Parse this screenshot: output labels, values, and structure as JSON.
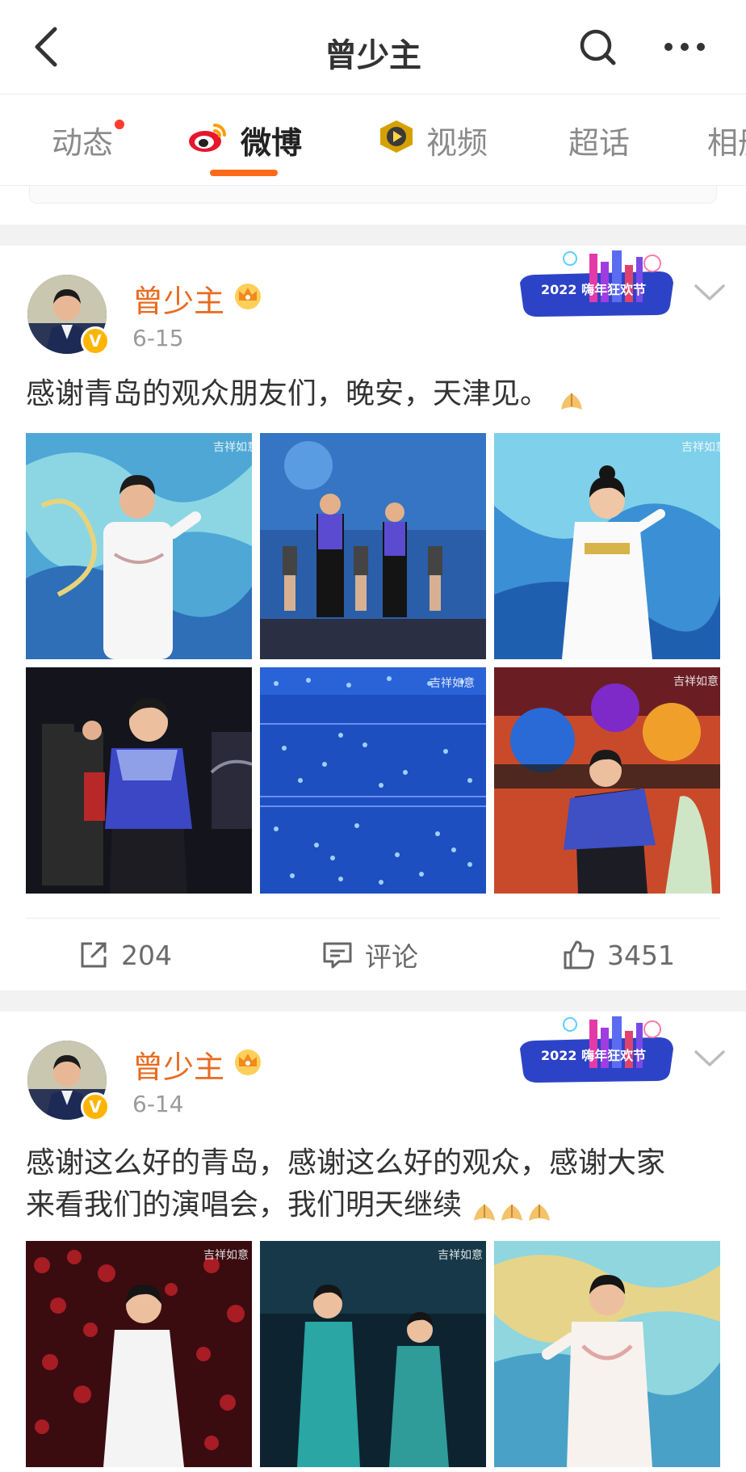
{
  "header": {
    "title": "曾少主"
  },
  "tabs": [
    {
      "label": "动态",
      "has_dot": true
    },
    {
      "label": "微博",
      "active": true
    },
    {
      "label": "视频"
    },
    {
      "label": "超话"
    },
    {
      "label": "相册"
    }
  ],
  "posts": [
    {
      "username": "曾少主",
      "date": "6-15",
      "badge_text": "2022 嗨年狂欢节",
      "text": "感谢青岛的观众朋友们，晚安，天津见。",
      "watermark": "吉祥如意",
      "stats": {
        "repost": "204",
        "comment": "评论",
        "like": "3451"
      }
    },
    {
      "username": "曾少主",
      "date": "6-14",
      "badge_text": "2022 嗨年狂欢节",
      "text_line1": "感谢这么好的青岛，感谢这么好的观众，感谢大家",
      "text_line2": "来看我们的演唱会，我们明天继续",
      "watermark": "吉祥如意"
    }
  ],
  "colors": {
    "accent": "#ff6a1a",
    "username": "#e86b1f",
    "vip": "#ffb400"
  }
}
